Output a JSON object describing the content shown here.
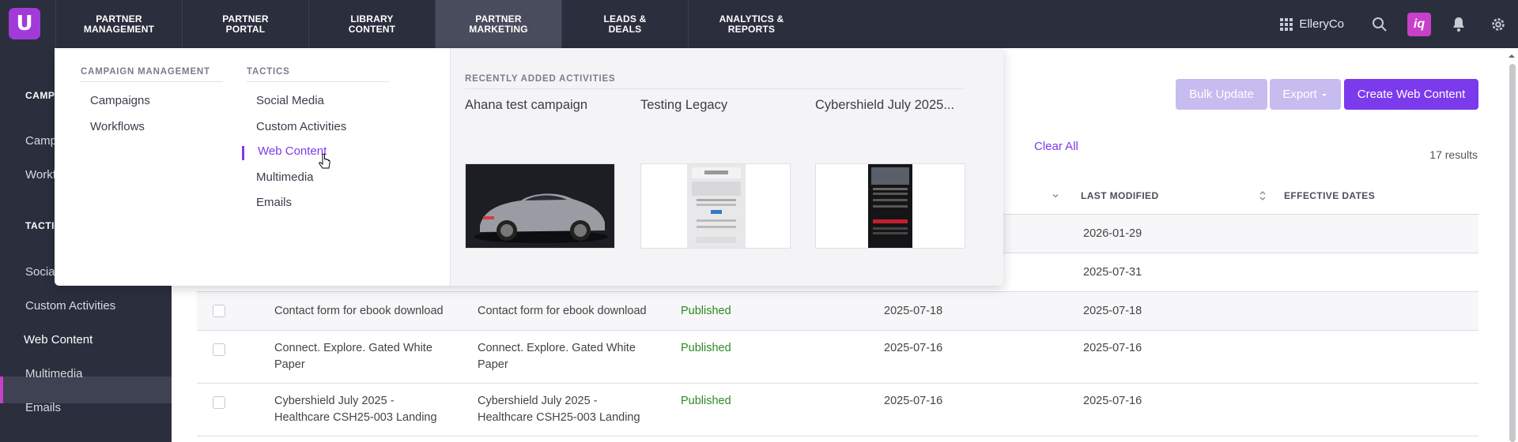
{
  "app": {
    "logo_letter": "U",
    "org_name": "ElleryCo",
    "iq_label": "iq"
  },
  "topnav": {
    "items": [
      {
        "label": "PARTNER MANAGEMENT"
      },
      {
        "label": "PARTNER PORTAL"
      },
      {
        "label": "LIBRARY CONTENT"
      },
      {
        "label": "PARTNER MARKETING"
      },
      {
        "label": "LEADS & DEALS"
      },
      {
        "label": "ANALYTICS & REPORTS"
      }
    ],
    "active": "PARTNER MARKETING"
  },
  "sidebar": {
    "heading1": "CAMP",
    "items_top": [
      "Camp",
      "Workf"
    ],
    "heading2": "TACTI",
    "items": [
      {
        "label": "Socia"
      },
      {
        "label": "Custom Activities"
      },
      {
        "label": "Web Content"
      },
      {
        "label": "Multimedia"
      },
      {
        "label": "Emails"
      }
    ],
    "active": "Web Content"
  },
  "mega_menu": {
    "campaign_management": {
      "heading": "CAMPAIGN MANAGEMENT",
      "items": [
        "Campaigns",
        "Workflows"
      ]
    },
    "tactics": {
      "heading": "TACTICS",
      "items": [
        "Social Media",
        "Custom Activities",
        "Web Content",
        "Multimedia",
        "Emails"
      ],
      "active": "Web Content"
    },
    "recent": {
      "heading": "RECENTLY ADDED ACTIVITIES",
      "items": [
        {
          "title": "Ahana test campaign"
        },
        {
          "title": "Testing Legacy"
        },
        {
          "title": "Cybershield July 2025..."
        }
      ]
    }
  },
  "toolbar": {
    "bulk_update": "Bulk Update",
    "export": "Export",
    "create": "Create Web Content",
    "clear_all": "Clear All",
    "results": "17 results"
  },
  "table": {
    "columns": {
      "last_modified": "LAST MODIFIED",
      "effective_dates": "EFFECTIVE DATES"
    },
    "rows": [
      {
        "name": "",
        "title": "",
        "status": "",
        "created": "",
        "modified": "2026-01-29"
      },
      {
        "name": "",
        "title": "",
        "status": "",
        "created": "",
        "modified": "2025-07-31"
      },
      {
        "name": "Contact form for ebook download",
        "title": "Contact form for ebook download",
        "status": "Published",
        "created": "2025-07-18",
        "modified": "2025-07-18"
      },
      {
        "name": "Connect. Explore. Gated White Paper",
        "title": "Connect. Explore. Gated White Paper",
        "status": "Published",
        "created": "2025-07-16",
        "modified": "2025-07-16"
      },
      {
        "name": "Cybershield July 2025 - Healthcare CSH25-003 Landing",
        "title": "Cybershield July 2025 - Healthcare CSH25-003 Landing",
        "status": "Published",
        "created": "2025-07-16",
        "modified": "2025-07-16"
      }
    ]
  },
  "colors": {
    "nav_bg": "#2b2e3d",
    "accent": "#7c3aed",
    "brand_magenta": "#c83fc9",
    "published_green": "#2d8a22"
  },
  "icons": [
    "apps-grid-icon",
    "search-icon",
    "bell-icon",
    "gear-icon",
    "chevron-down-icon",
    "sort-icon"
  ]
}
